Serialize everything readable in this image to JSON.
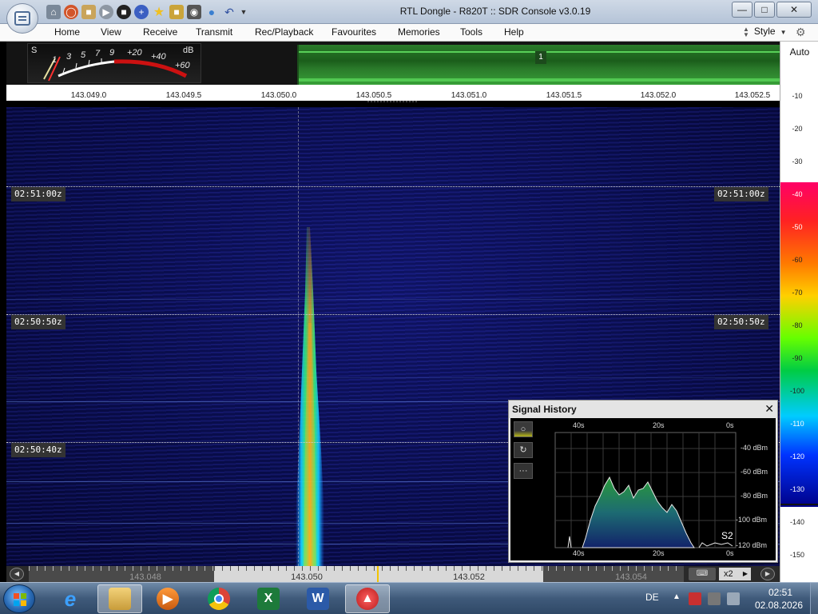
{
  "window": {
    "title": "RTL Dongle - R820T :: SDR Console v3.0.19",
    "min_glyph": "—",
    "max_glyph": "□",
    "close_glyph": "✕"
  },
  "quick_access": [
    "home-icon",
    "lifebuoy-icon",
    "folder-icon",
    "play-icon",
    "stop-icon",
    "plus-icon",
    "star-icon",
    "lock-icon",
    "camera-icon",
    "drop-icon",
    "undo-icon",
    "dropdown-arrow-icon"
  ],
  "menu": {
    "items": [
      "Home",
      "View",
      "Receive",
      "Transmit",
      "Rec/Playback",
      "Favourites",
      "Memories",
      "Tools",
      "Help"
    ],
    "style_label": "Style"
  },
  "smeter": {
    "s_label": "S",
    "db_label": "dB",
    "scale": [
      "1",
      "3",
      "5",
      "7",
      "9",
      "+20",
      "+40",
      "+60"
    ]
  },
  "spectrum": {
    "vfo_number": "1"
  },
  "freq_axis": {
    "labels": [
      "143.049.0",
      "143.049.5",
      "143.050.0",
      "143.050.5",
      "143.051.0",
      "143.051.5",
      "143.052.0",
      "143.052.5"
    ]
  },
  "waterfall": {
    "timestamps": [
      "02:51:00z",
      "02:50:50z",
      "02:50:40z"
    ]
  },
  "level_scale": {
    "auto_label": "Auto",
    "labels": [
      "-10",
      "-20",
      "-30",
      "-40",
      "-50",
      "-60",
      "-70",
      "-80",
      "-90",
      "-100",
      "-110",
      "-120",
      "-130",
      "-140",
      "-150"
    ]
  },
  "bottom_bar": {
    "freqs": [
      "143.048",
      "143.050",
      "143.052",
      "143.054"
    ],
    "keyboard_glyph": "⌨",
    "zoom_label": "x2",
    "zoom_glyph": "▶",
    "left_glyph": "◀",
    "right_glyph": "▶"
  },
  "signal_history": {
    "title": "Signal History",
    "close_glyph": "✕",
    "tool_glyphs": [
      "○",
      "↻",
      "···"
    ],
    "time_labels_top": [
      "40s",
      "20s",
      "0s"
    ],
    "time_labels_bottom": [
      "40s",
      "20s",
      "0s"
    ],
    "level_labels": [
      "-40 dBm",
      "-60 dBm",
      "-80 dBm",
      "-100 dBm",
      "-120 dBm"
    ],
    "s_reading": "S2"
  },
  "taskbar": {
    "apps": [
      "explorer-app",
      "internet-explorer-app",
      "windows-explorer-app",
      "media-player-app",
      "chrome-app",
      "excel-app",
      "word-app",
      "sdr-console-app"
    ],
    "active_app": "sdr-console-app",
    "excel_glyph": "X",
    "word_glyph": "W",
    "language": "DE",
    "tray_up_glyph": "▲",
    "time": "02:51",
    "date": "02.08.2026"
  },
  "colors": {
    "accent_green": "#2a7a2a",
    "waterfall_blue": "#0a0f4e",
    "signal_hot": "#ff9a20"
  }
}
